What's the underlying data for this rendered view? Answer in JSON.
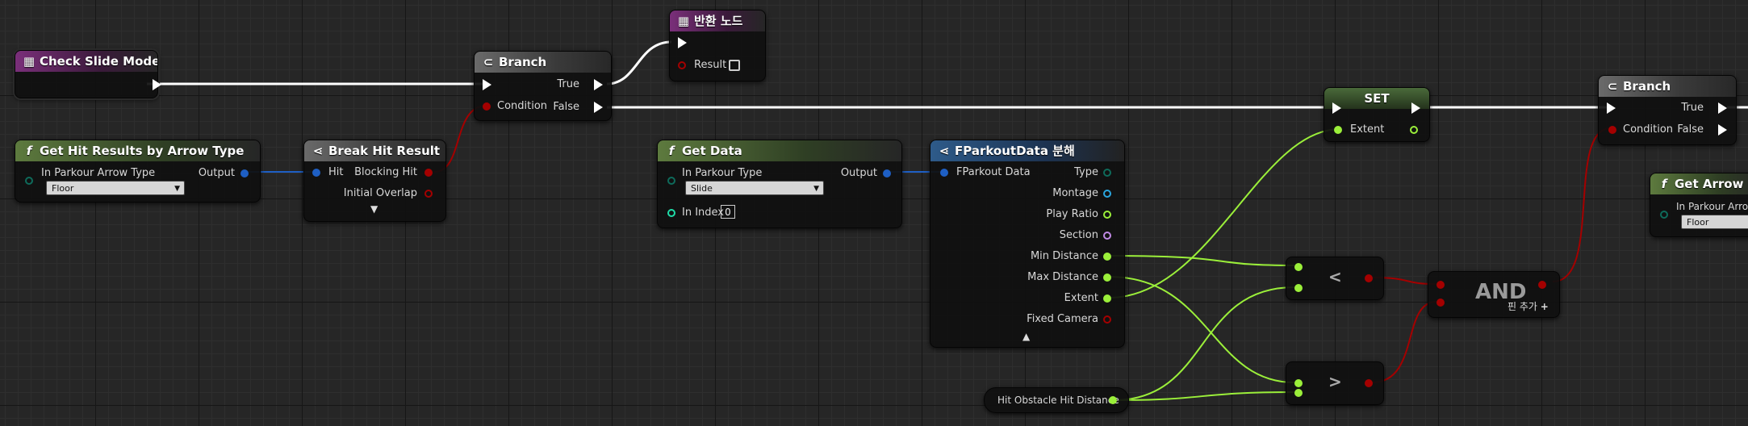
{
  "nodes": {
    "check_slide_mode": {
      "title": "Check Slide Mode"
    },
    "branch1": {
      "title": "Branch",
      "true_label": "True",
      "condition_label": "Condition",
      "false_label": "False"
    },
    "return_node": {
      "title": "반환 노드",
      "result_label": "Result"
    },
    "get_hit_results": {
      "title": "Get Hit Results by Arrow Type",
      "input_label": "In Parkour Arrow Type",
      "output_label": "Output",
      "dropdown_value": "Floor"
    },
    "break_hit_result": {
      "title": "Break Hit Result",
      "hit_label": "Hit",
      "blocking_label": "Blocking Hit",
      "overlap_label": "Initial Overlap"
    },
    "get_data": {
      "title": "Get Data",
      "input_label": "In Parkour Type",
      "output_label": "Output",
      "dropdown_value": "Slide",
      "index_label": "In Index",
      "index_value": "0"
    },
    "break_struct": {
      "title": "FParkoutData 분해",
      "input_label": "FParkout Data",
      "outputs": [
        "Type",
        "Montage",
        "Play Ratio",
        "Section",
        "Min Distance",
        "Max Distance",
        "Extent",
        "Fixed Camera"
      ]
    },
    "set_node": {
      "title": "SET",
      "extent_label": "Extent"
    },
    "branch2": {
      "title": "Branch",
      "true_label": "True",
      "condition_label": "Condition",
      "false_label": "False"
    },
    "get_arrow": {
      "title": "Get Arrow Com",
      "input_label": "In Parkour Arrow",
      "dropdown_value": "Floor"
    },
    "less_node": {
      "symbol": "<"
    },
    "greater_node": {
      "symbol": ">"
    },
    "and_node": {
      "title": "AND",
      "add_pin_label": "핀 추가"
    },
    "hit_distance": {
      "title": "Hit Obstacle Hit Distance"
    }
  },
  "colors": {
    "exec": "#ffffff",
    "float": "#9bef3a",
    "bool": "#a40000",
    "struct": "#1e5fc4",
    "enum": "#0e6b5b",
    "int": "#1fdca8",
    "object": "#2aa6e0",
    "name": "#c18ae6"
  }
}
